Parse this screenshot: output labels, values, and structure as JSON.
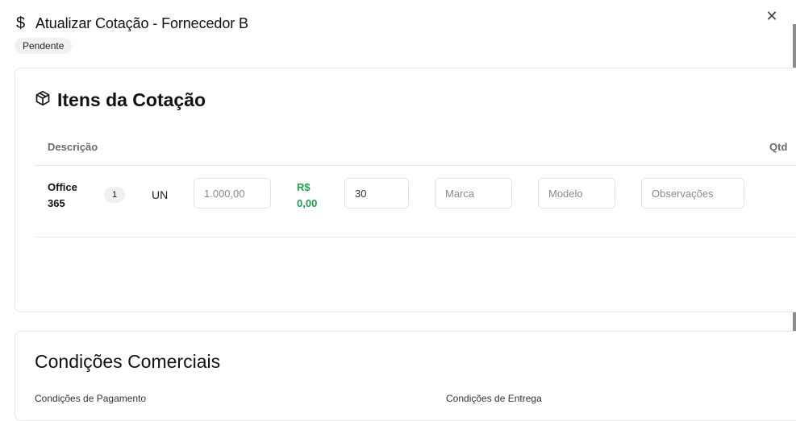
{
  "dialog": {
    "title": "Atualizar Cotação - Fornecedor B",
    "status_badge": "Pendente"
  },
  "items_section": {
    "title": "Itens da Cotação",
    "columns": {
      "description": "Descrição",
      "quantity": "Qtd"
    },
    "rows": [
      {
        "description_line1": "Office",
        "description_line2": "365",
        "quantity": "1",
        "unit": "UN",
        "price_placeholder": "1.000,00",
        "total_line1": "R$",
        "total_line2": "0,00",
        "delivery_days_value": "30",
        "brand_placeholder": "Marca",
        "model_placeholder": "Modelo",
        "observations_placeholder": "Observações"
      }
    ]
  },
  "terms_section": {
    "title": "Condições Comerciais",
    "payment_label": "Condições de Pagamento",
    "delivery_label": "Condições de Entrega"
  },
  "colors": {
    "total_value": "#1e9e4a",
    "badge_bg": "#f1f1f1"
  },
  "icons": {
    "title_icon": "dollar-icon",
    "close": "close-icon",
    "items_section": "package-icon"
  }
}
